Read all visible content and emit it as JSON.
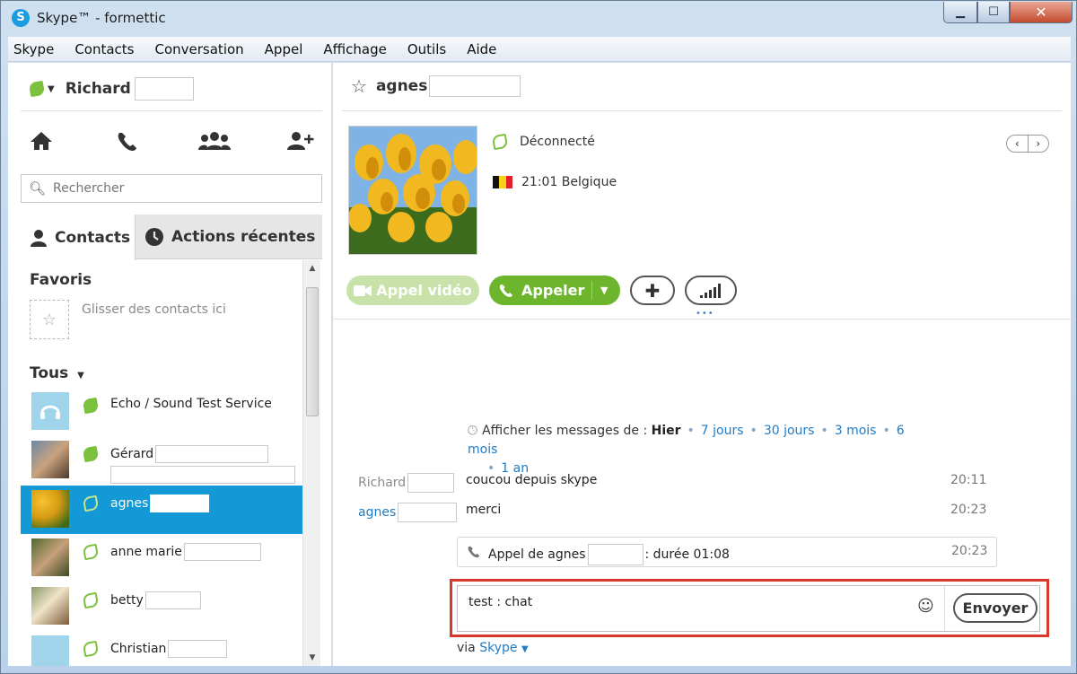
{
  "window": {
    "title": "Skype™ - formettic",
    "logo_letter": "S"
  },
  "menu": [
    "Skype",
    "Contacts",
    "Conversation",
    "Appel",
    "Affichage",
    "Outils",
    "Aide"
  ],
  "profile": {
    "name": "Richard"
  },
  "search": {
    "placeholder": "Rechercher"
  },
  "tabs": {
    "contacts": "Contacts",
    "recent": "Actions récentes"
  },
  "favorites": {
    "title": "Favoris",
    "hint": "Glisser des contacts ici"
  },
  "all": {
    "title": "Tous"
  },
  "contacts": [
    {
      "name": "Echo / Sound Test Service",
      "status": "online"
    },
    {
      "name": "Gérard",
      "status": "online"
    },
    {
      "name": "agnes",
      "status": "offline",
      "selected": true
    },
    {
      "name": "anne marie",
      "status": "offline"
    },
    {
      "name": "betty",
      "status": "offline"
    },
    {
      "name": "Christian",
      "status": "offline"
    }
  ],
  "conversation": {
    "name": "agnes",
    "presence": "Déconnecté",
    "locale": "21:01 Belgique",
    "buttons": {
      "video": "Appel vidéo",
      "call": "Appeler"
    },
    "history": {
      "prefix": "Afficher les messages de :",
      "current": "Hier",
      "links": [
        "7 jours",
        "30 jours",
        "3 mois",
        "6 mois",
        "1 an"
      ]
    },
    "messages": [
      {
        "sender": "Richard",
        "text": "coucou depuis skype",
        "time": "20:11",
        "sender_color": "#8a8a8a"
      },
      {
        "sender": "agnes",
        "text": "merci",
        "time": "20:23",
        "sender_color": "#1f7bc4"
      }
    ],
    "call": {
      "prefix": "Appel de agnes",
      "suffix": ": durée 01:08",
      "time": "20:23"
    },
    "input_value": "test : chat",
    "send_label": "Envoyer",
    "via_prefix": "via",
    "via_link": "Skype"
  },
  "colors": {
    "accent": "#1399d6",
    "online": "#7cc13e",
    "call_green": "#6db52d",
    "highlight_frame": "#d9382c"
  }
}
